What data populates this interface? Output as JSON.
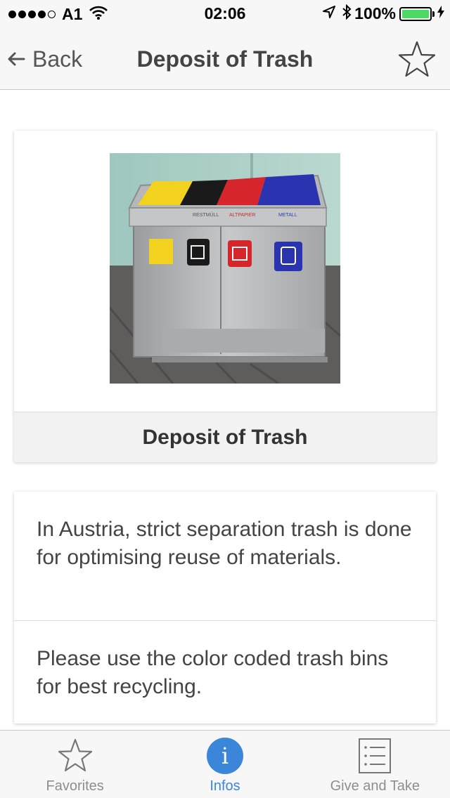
{
  "status_bar": {
    "carrier": "A1",
    "time": "02:06",
    "battery": "100%",
    "battery_color": "#4cd964"
  },
  "nav": {
    "back_label": "Back",
    "title": "Deposit of Trash",
    "back_icon": "arrow-left-icon",
    "favorite_icon": "star-outline-icon"
  },
  "image_card": {
    "caption": "Deposit of Trash",
    "bins": [
      {
        "label": "",
        "color": "#f2d21f"
      },
      {
        "label": "RESTMÜLL",
        "color": "#1a1a1a"
      },
      {
        "label": "ALTPAPIER",
        "color": "#d6262c"
      },
      {
        "label": "METALL",
        "color": "#2a33b0"
      }
    ]
  },
  "info_card": {
    "paragraphs": [
      "In Austria, strict separation trash is done for optimising reuse of materials.",
      "Please use the color coded trash bins for best recycling."
    ]
  },
  "tabs": [
    {
      "label": "Favorites",
      "icon": "star-outline-icon",
      "active": false
    },
    {
      "label": "Infos",
      "icon": "info-icon",
      "active": true
    },
    {
      "label": "Give and Take",
      "icon": "list-icon",
      "active": false
    }
  ],
  "colors": {
    "accent": "#3c86d9",
    "nav_background": "#f7f7f7",
    "inactive_tab": "#8e8e8e"
  }
}
